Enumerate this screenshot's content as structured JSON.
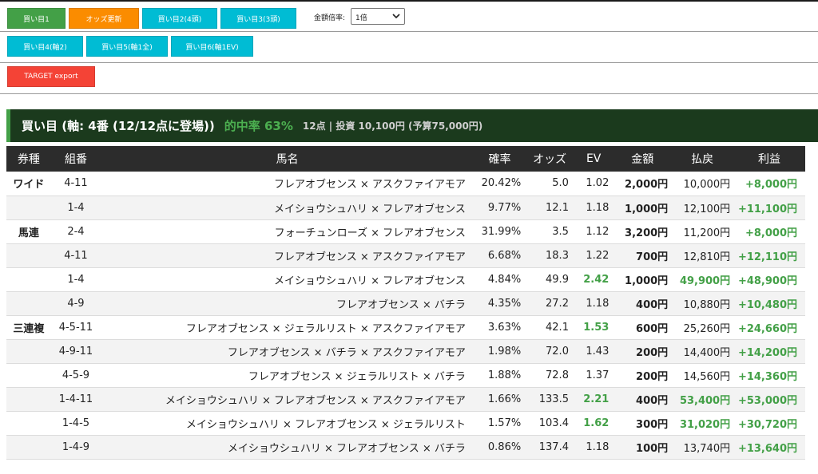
{
  "toolbar": {
    "buy1": "買い目1",
    "odds_update": "オッズ更新",
    "buy2": "買い目2(4頭)",
    "buy3": "買い目3(3頭)",
    "multiplier_label": "金額倍率:",
    "multiplier_value": "1倍",
    "buy4": "買い目4(軸2)",
    "buy5": "買い目5(軸1全)",
    "buy6": "買い目6(軸1EV)",
    "target_export": "TARGET export"
  },
  "summary": {
    "title": "買い目 (軸: 4番 (12/12点に登場))",
    "hit_rate": "的中率 63%",
    "meta": "12点 | 投資 10,100円 (予算75,000円)"
  },
  "table": {
    "headers": {
      "type": "券種",
      "combo": "組番",
      "horse": "馬名",
      "prob": "確率",
      "odds": "オッズ",
      "ev": "EV",
      "amount": "金額",
      "payout": "払戻",
      "profit": "利益"
    },
    "rows": [
      {
        "type": "ワイド",
        "combo": "4-11",
        "horse": "フレアオブセンス × アスクファイアモア",
        "prob": "20.42%",
        "odds": "5.0",
        "ev": "1.02",
        "amount": "2,000円",
        "payout": "10,000円",
        "profit": "+8,000円"
      },
      {
        "type": "",
        "combo": "1-4",
        "horse": "メイショウシュハリ × フレアオブセンス",
        "prob": "9.77%",
        "odds": "12.1",
        "ev": "1.18",
        "amount": "1,000円",
        "payout": "12,100円",
        "profit": "+11,100円"
      },
      {
        "type": "馬連",
        "combo": "2-4",
        "horse": "フォーチュンローズ × フレアオブセンス",
        "prob": "31.99%",
        "odds": "3.5",
        "ev": "1.12",
        "amount": "3,200円",
        "payout": "11,200円",
        "profit": "+8,000円"
      },
      {
        "type": "",
        "combo": "4-11",
        "horse": "フレアオブセンス × アスクファイアモア",
        "prob": "6.68%",
        "odds": "18.3",
        "ev": "1.22",
        "amount": "700円",
        "payout": "12,810円",
        "profit": "+12,110円"
      },
      {
        "type": "",
        "combo": "1-4",
        "horse": "メイショウシュハリ × フレアオブセンス",
        "prob": "4.84%",
        "odds": "49.9",
        "ev": "2.42",
        "amount": "1,000円",
        "payout": "49,900円",
        "profit": "+48,900円"
      },
      {
        "type": "",
        "combo": "4-9",
        "horse": "フレアオブセンス × バチラ",
        "prob": "4.35%",
        "odds": "27.2",
        "ev": "1.18",
        "amount": "400円",
        "payout": "10,880円",
        "profit": "+10,480円"
      },
      {
        "type": "三連複",
        "combo": "4-5-11",
        "horse": "フレアオブセンス × ジェラルリスト × アスクファイアモア",
        "prob": "3.63%",
        "odds": "42.1",
        "ev": "1.53",
        "amount": "600円",
        "payout": "25,260円",
        "profit": "+24,660円"
      },
      {
        "type": "",
        "combo": "4-9-11",
        "horse": "フレアオブセンス × バチラ × アスクファイアモア",
        "prob": "1.98%",
        "odds": "72.0",
        "ev": "1.43",
        "amount": "200円",
        "payout": "14,400円",
        "profit": "+14,200円"
      },
      {
        "type": "",
        "combo": "4-5-9",
        "horse": "フレアオブセンス × ジェラルリスト × バチラ",
        "prob": "1.88%",
        "odds": "72.8",
        "ev": "1.37",
        "amount": "200円",
        "payout": "14,560円",
        "profit": "+14,360円"
      },
      {
        "type": "",
        "combo": "1-4-11",
        "horse": "メイショウシュハリ × フレアオブセンス × アスクファイアモア",
        "prob": "1.66%",
        "odds": "133.5",
        "ev": "2.21",
        "amount": "400円",
        "payout": "53,400円",
        "profit": "+53,000円"
      },
      {
        "type": "",
        "combo": "1-4-5",
        "horse": "メイショウシュハリ × フレアオブセンス × ジェラルリスト",
        "prob": "1.57%",
        "odds": "103.4",
        "ev": "1.62",
        "amount": "300円",
        "payout": "31,020円",
        "profit": "+30,720円"
      },
      {
        "type": "",
        "combo": "1-4-9",
        "horse": "メイショウシュハリ × フレアオブセンス × バチラ",
        "prob": "0.86%",
        "odds": "137.4",
        "ev": "1.18",
        "amount": "100円",
        "payout": "13,740円",
        "profit": "+13,640円"
      }
    ]
  },
  "colors": {
    "green": "#43a047",
    "orange": "#fb8c00",
    "cyan": "#00bcd4",
    "red": "#f44336",
    "summary_bg": "#1b3a1d",
    "header_bg": "#2c2c2c"
  }
}
